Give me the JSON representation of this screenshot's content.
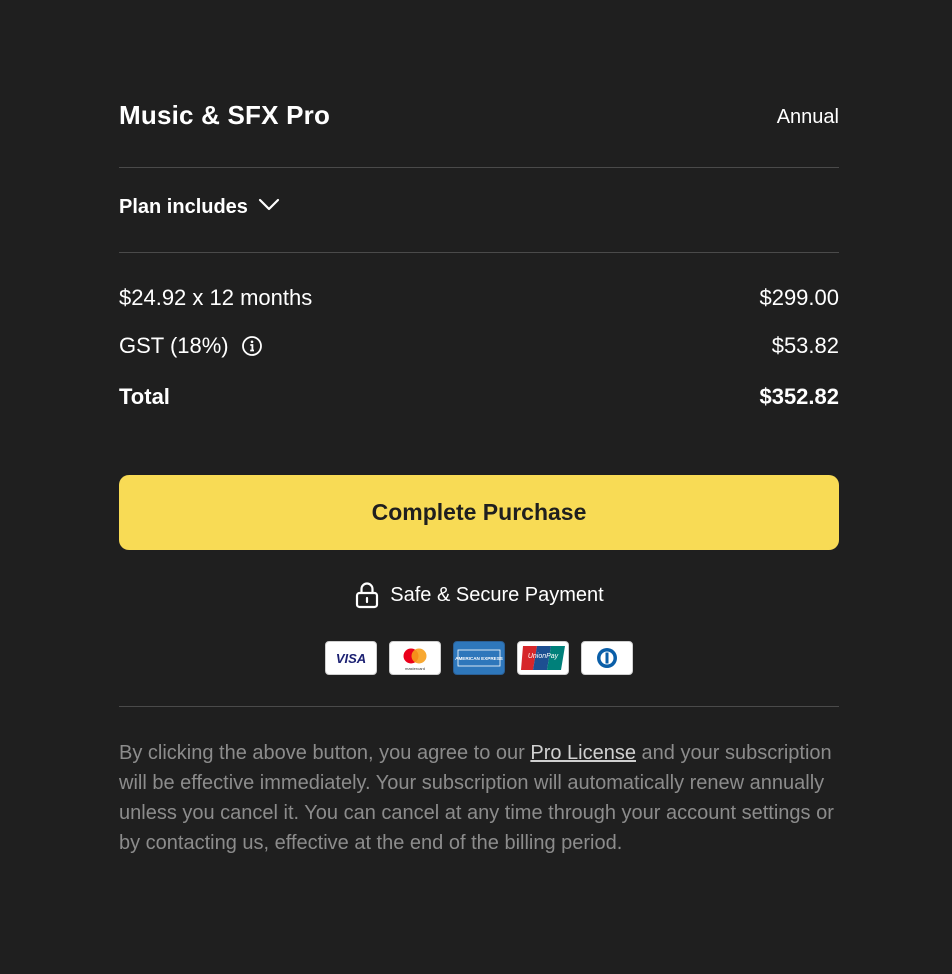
{
  "header": {
    "plan_name": "Music & SFX Pro",
    "billing_period": "Annual"
  },
  "plan_toggle": {
    "label": "Plan includes",
    "icon": "chevron-down-icon"
  },
  "summary": {
    "subtotal": {
      "label": "$24.92 x 12 months",
      "value": "$299.00"
    },
    "tax": {
      "label": "GST (18%)",
      "value": "$53.82",
      "icon": "info-icon"
    },
    "total": {
      "label": "Total",
      "value": "$352.82"
    }
  },
  "purchase_button": {
    "label": "Complete Purchase",
    "color": "#f8db55"
  },
  "secure": {
    "label": "Safe & Secure Payment",
    "icon": "lock-icon"
  },
  "payment_methods": [
    {
      "name": "visa",
      "label": "VISA"
    },
    {
      "name": "mastercard",
      "label": "mastercard"
    },
    {
      "name": "american-express",
      "label": "AMERICAN EXPRESS"
    },
    {
      "name": "unionpay",
      "label": "UnionPay"
    },
    {
      "name": "diners-club",
      "label": ""
    }
  ],
  "legal": {
    "before": "By clicking the above button, you agree to our ",
    "link": "Pro License",
    "after": " and your subscription will be effective immediately. Your subscription will automatically renew annually unless you cancel it. You can cancel at any time through your account settings or by contacting us, effective at the end of the billing period."
  },
  "colors": {
    "background": "#1f1f1f",
    "text": "#ffffff",
    "muted": "#8c8c8c",
    "accent": "#f8db55"
  }
}
